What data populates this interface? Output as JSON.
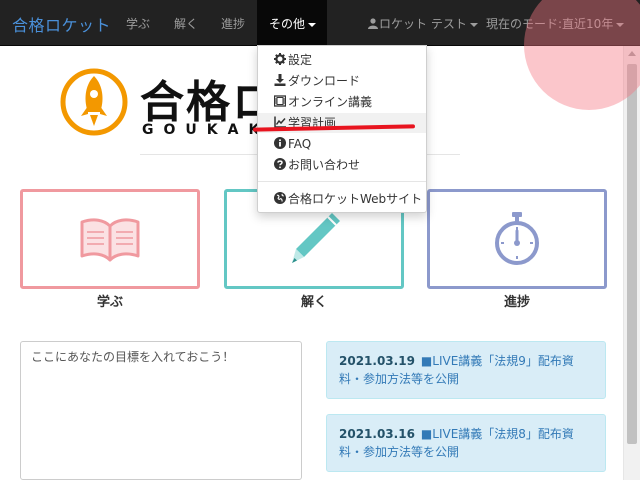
{
  "navbar": {
    "brand": "合格ロケット",
    "links": [
      "学ぶ",
      "解く",
      "進捗"
    ],
    "active_menu": "その他",
    "user": "ロケット テスト",
    "mode": "現在のモード:直近10年"
  },
  "logo": {
    "jp": "合格ロ",
    "en": "GOUKAK"
  },
  "dropdown": {
    "items": [
      "設定",
      "ダウンロード",
      "オンライン講義",
      "学習計画",
      "FAQ",
      "お問い合わせ"
    ],
    "website": "合格ロケットWebサイト"
  },
  "tiles": [
    {
      "label": "学ぶ",
      "color": "#f0999f",
      "icon": "book-icon"
    },
    {
      "label": "解く",
      "color": "#63c7c4",
      "icon": "pencil-icon"
    },
    {
      "label": "進捗",
      "color": "#8c99cc",
      "icon": "stopwatch-icon"
    }
  ],
  "goal": {
    "placeholder": "ここにあなたの目標を入れておこう！"
  },
  "news": [
    {
      "date": "2021.03.19",
      "title": "■LIVE講義「法規9」配布資料・参加方法等を公開"
    },
    {
      "date": "2021.03.16",
      "title": "■LIVE講義「法規8」配布資料・参加方法等を公開"
    }
  ],
  "colors": {
    "navbar": "#222222",
    "brand": "#4a90d9",
    "logo_orange": "#f39800",
    "news_bg": "#d9edf7",
    "annotation_red": "#e8141f"
  }
}
